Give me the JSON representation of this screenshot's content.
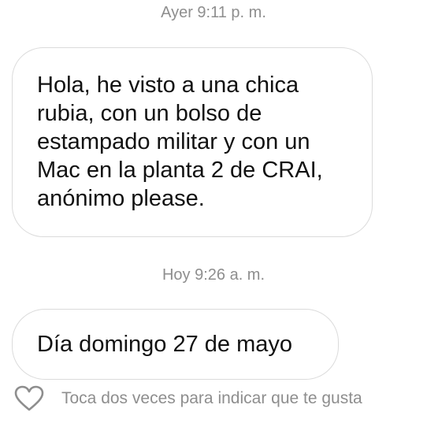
{
  "conversation": {
    "messages": [
      {
        "timestamp": "Ayer 9:11 p. m.",
        "text": "Hola, he visto a una chica rubia, con un bolso de estampado militar y con un Mac en la planta 2 de CRAI, anónimo please."
      },
      {
        "timestamp": "Hoy 9:26 a. m.",
        "text": "Día domingo 27 de mayo"
      }
    ]
  },
  "like_hint": {
    "icon": "heart-outline-icon",
    "text": "Toca dos veces para indicar que te gusta"
  },
  "colors": {
    "background": "#ffffff",
    "bubble_border": "#dbdbdb",
    "muted_text": "#8e8e8e",
    "message_text": "#111111"
  }
}
